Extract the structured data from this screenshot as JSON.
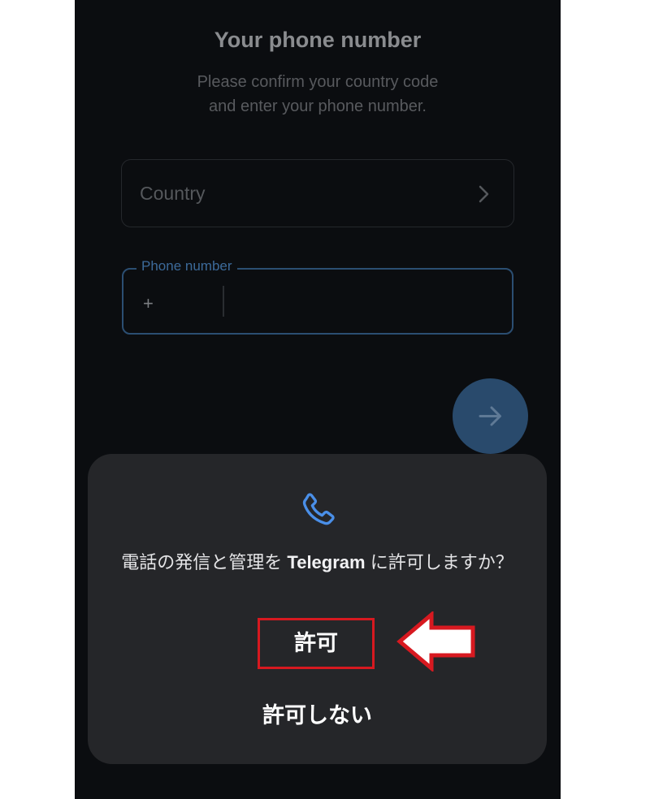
{
  "screen": {
    "title": "Your phone number",
    "subtitle_line1": "Please confirm your country code",
    "subtitle_line2": "and enter your phone number."
  },
  "country_field": {
    "placeholder": "Country",
    "icon": "chevron-right-icon"
  },
  "phone_field": {
    "label": "Phone number",
    "prefix": "+"
  },
  "next_button": {
    "icon": "arrow-right-icon"
  },
  "permission_dialog": {
    "icon": "phone-call-icon",
    "question_before": "電話の発信と管理を",
    "app_name": "Telegram",
    "question_after": "に許可しますか？",
    "allow_label": "許可",
    "deny_label": "許可しない"
  },
  "annotation": {
    "highlight_color": "#d71920",
    "arrow_color": "#d71920",
    "arrow_icon": "left-arrow-icon"
  },
  "colors": {
    "background": "#0b0d10",
    "dialog": "#252629",
    "accent": "#2b4e72",
    "phone_icon": "#4a8fe8"
  }
}
